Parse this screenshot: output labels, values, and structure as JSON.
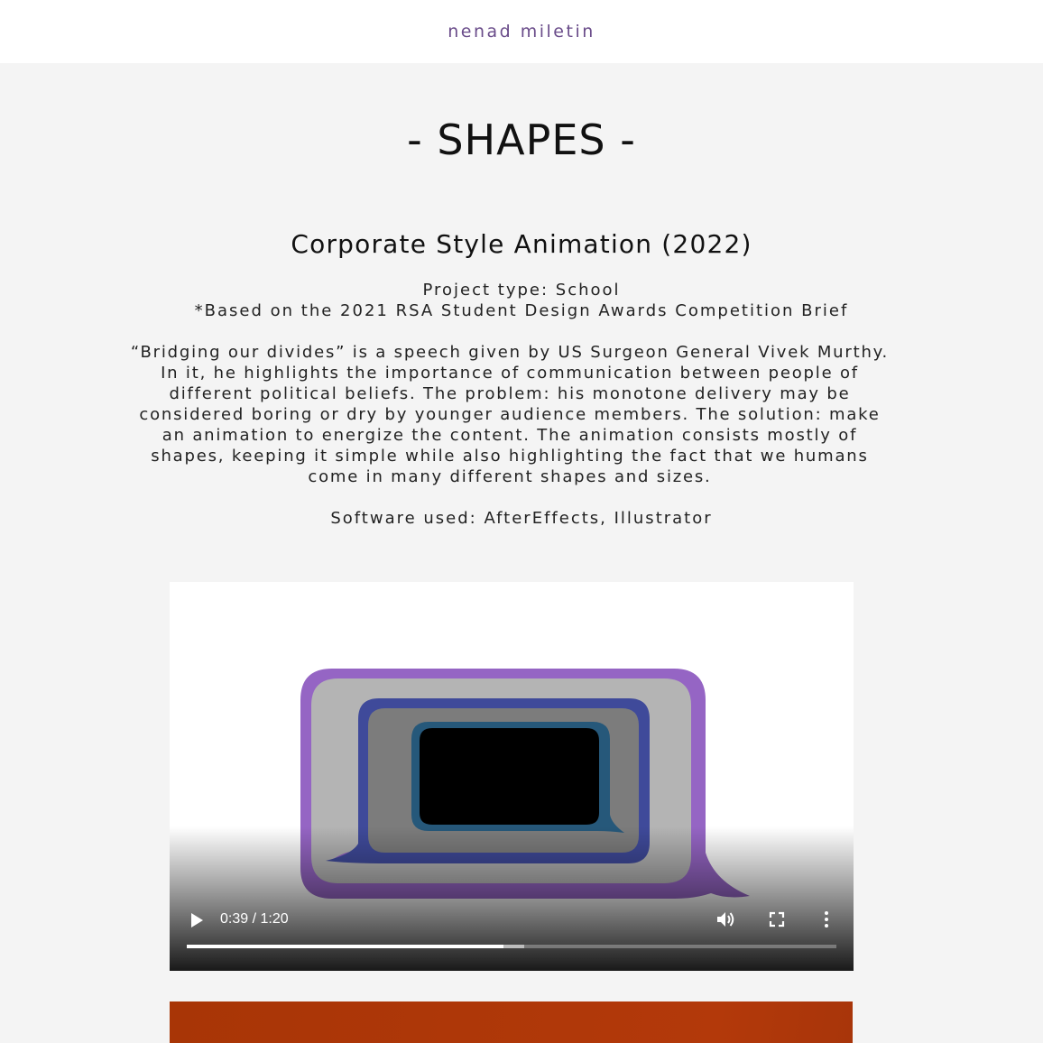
{
  "header": {
    "site_name": "nenad miletin"
  },
  "page": {
    "title": "- SHAPES -"
  },
  "project": {
    "title": "Corporate Style Animation (2022)",
    "type_line": "Project type: School",
    "brief_line": "*Based on the 2021 RSA Student Design Awards Competition Brief",
    "description_lines": [
      "“Bridging our divides” is a speech given by US Surgeon General Vivek Murthy.",
      "In it, he highlights the importance of communication between people of",
      "different political beliefs. The problem: his monotone delivery may be",
      "considered boring or dry by younger audience members. The solution: make",
      "an animation to energize the content. The animation consists mostly of",
      "shapes, keeping it simple while also highlighting the fact that we humans",
      "come in many different shapes and sizes."
    ],
    "software_line": "Software used: AfterEffects, Illustrator"
  },
  "video": {
    "time_display": "0:39 / 1:20",
    "played_fraction": 0.488,
    "buffered_fraction": 0.52,
    "icons": {
      "play": "play-icon",
      "volume": "volume-icon",
      "fullscreen": "fullscreen-icon",
      "more": "more-options-icon"
    },
    "colors": {
      "outer_bubble": "#9565c4",
      "middle_bubble": "#3f4a9a",
      "inner_bubble": "#26587a"
    }
  },
  "next_section": {
    "color": "#ad380a"
  }
}
